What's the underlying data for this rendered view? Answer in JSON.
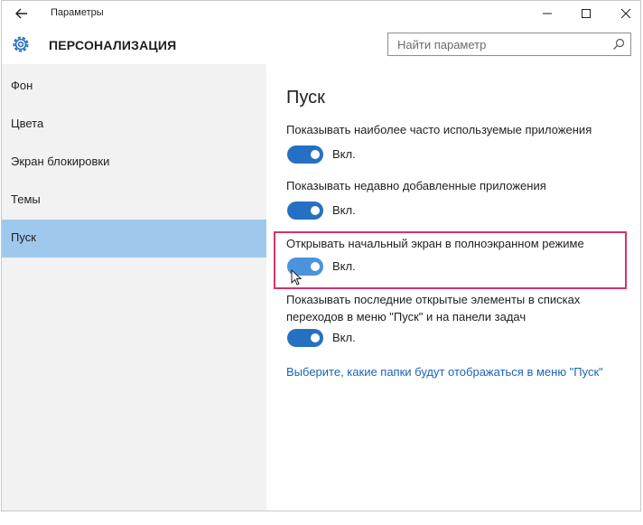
{
  "window": {
    "title": "Параметры",
    "controls": [
      "minimize",
      "maximize",
      "close"
    ]
  },
  "header": {
    "section_title": "ПЕРСОНАЛИЗАЦИЯ",
    "search_placeholder": "Найти параметр",
    "icons": [
      "back-arrow",
      "gear",
      "search"
    ]
  },
  "sidebar": {
    "items": [
      {
        "label": "Фон",
        "active": false
      },
      {
        "label": "Цвета",
        "active": false
      },
      {
        "label": "Экран блокировки",
        "active": false
      },
      {
        "label": "Темы",
        "active": false
      },
      {
        "label": "Пуск",
        "active": true
      }
    ]
  },
  "main": {
    "title": "Пуск",
    "options": [
      {
        "label": "Показывать наиболее часто используемые приложения",
        "state": "Вкл."
      },
      {
        "label": "Показывать недавно добавленные приложения",
        "state": "Вкл."
      },
      {
        "label": "Открывать начальный экран в полноэкранном режиме",
        "state": "Вкл.",
        "highlighted": true
      },
      {
        "label": "Показывать последние открытые элементы в списках переходов в меню \"Пуск\" и на панели задач",
        "state": "Вкл."
      }
    ],
    "link": "Выберите, какие папки будут отображаться в меню \"Пуск\""
  },
  "colors": {
    "accent": "#2670c3",
    "sidebar_active": "#9fc9ec",
    "highlight_border": "#d4336f",
    "link": "#1a63b8"
  }
}
